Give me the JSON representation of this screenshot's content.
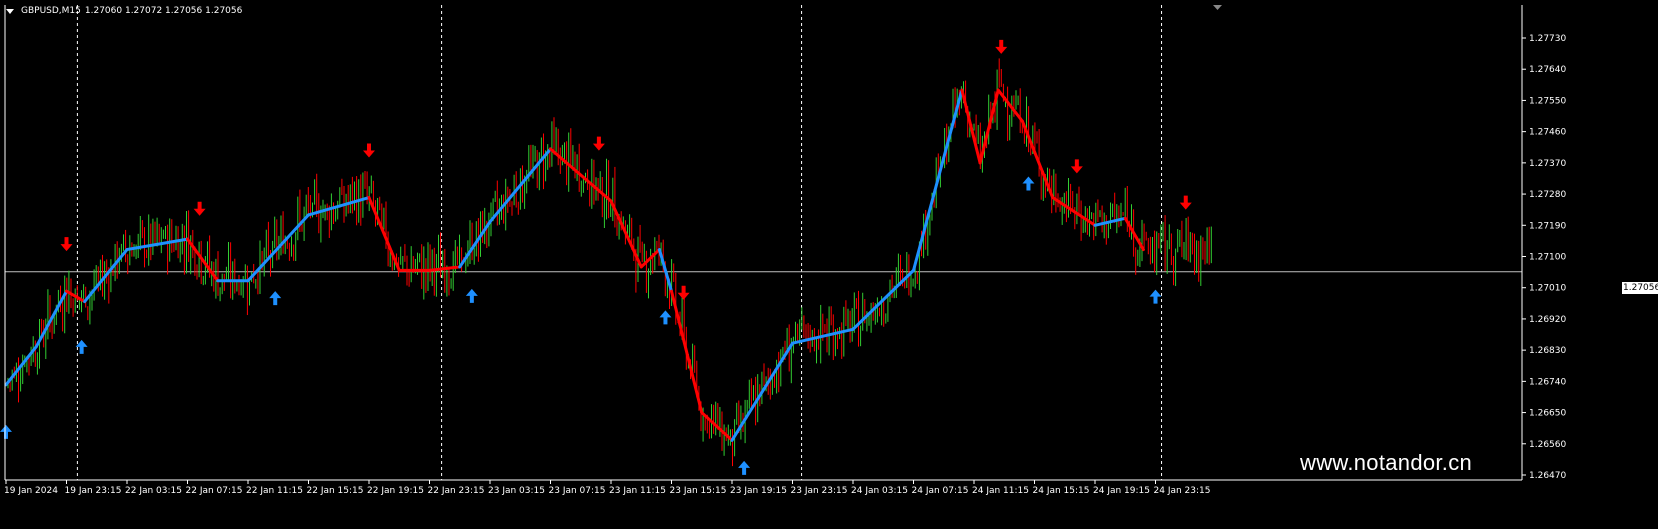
{
  "header": {
    "symbol_timeframe": "GBPUSD,M15",
    "quote_text": "1.27060 1.27072 1.27056 1.27056"
  },
  "price_axis": {
    "labels": [
      "1.27730",
      "1.27640",
      "1.27550",
      "1.27460",
      "1.27370",
      "1.27280",
      "1.27190",
      "1.27100",
      "1.27010",
      "1.26920",
      "1.26830",
      "1.26740",
      "1.26650",
      "1.26560",
      "1.26470"
    ],
    "current_price": "1.27056"
  },
  "time_axis": {
    "labels": [
      "19 Jan 2024",
      "19 Jan 23:15",
      "22 Jan 03:15",
      "22 Jan 07:15",
      "22 Jan 11:15",
      "22 Jan 15:15",
      "22 Jan 19:15",
      "22 Jan 23:15",
      "23 Jan 03:15",
      "23 Jan 07:15",
      "23 Jan 11:15",
      "23 Jan 15:15",
      "23 Jan 19:15",
      "23 Jan 23:15",
      "24 Jan 03:15",
      "24 Jan 07:15",
      "24 Jan 11:15",
      "24 Jan 15:15",
      "24 Jan 19:15",
      "24 Jan 23:15"
    ]
  },
  "watermark": "www.notandor.cn",
  "colors": {
    "background": "#000000",
    "bull_candle": "#32cd32",
    "bear_candle": "#ff0000",
    "trend_up": "#1e90ff",
    "trend_down": "#ff0000",
    "signal_up": "#1e90ff",
    "signal_down": "#ff0000",
    "grid_separator": "#ffffff"
  },
  "chart_data": {
    "type": "line",
    "symbol": "GBPUSD",
    "timeframe": "M15",
    "ylim": [
      1.2647,
      1.2782
    ],
    "current_price": 1.27056,
    "x_labels": [
      "19 Jan 2024",
      "19 Jan 23:15",
      "22 Jan 03:15",
      "22 Jan 07:15",
      "22 Jan 11:15",
      "22 Jan 15:15",
      "22 Jan 19:15",
      "22 Jan 23:15",
      "23 Jan 03:15",
      "23 Jan 07:15",
      "23 Jan 11:15",
      "23 Jan 15:15",
      "23 Jan 19:15",
      "23 Jan 23:15",
      "24 Jan 03:15",
      "24 Jan 07:15",
      "24 Jan 11:15",
      "24 Jan 15:15",
      "24 Jan 19:15",
      "24 Jan 23:15"
    ],
    "series": [
      {
        "points": [
          [
            0,
            1.2673,
            "up"
          ],
          [
            0.5,
            1.2684,
            "up"
          ],
          [
            1,
            1.27,
            "down"
          ],
          [
            1.3,
            1.2697,
            "up"
          ],
          [
            2,
            1.2712,
            "up"
          ],
          [
            3,
            1.2715,
            "down"
          ],
          [
            3.5,
            1.2703,
            "up"
          ],
          [
            4,
            1.2703,
            "up"
          ],
          [
            5,
            1.2722,
            "up"
          ],
          [
            6,
            1.2727,
            "down"
          ],
          [
            6.5,
            1.2706,
            "down"
          ],
          [
            7,
            1.2706,
            "down"
          ],
          [
            7.5,
            1.2707,
            "up"
          ],
          [
            8,
            1.272,
            "up"
          ],
          [
            9,
            1.2741,
            "down"
          ],
          [
            10,
            1.2726,
            "down"
          ],
          [
            10.5,
            1.2707,
            "down"
          ],
          [
            10.8,
            1.2712,
            "up"
          ],
          [
            11,
            1.27,
            "down"
          ],
          [
            11.5,
            1.2665,
            "down"
          ],
          [
            12,
            1.2657,
            "up"
          ],
          [
            13,
            1.2685,
            "up"
          ],
          [
            14,
            1.2689,
            "up"
          ],
          [
            15,
            1.2706,
            "up"
          ],
          [
            15.8,
            1.2758,
            "down"
          ],
          [
            16.1,
            1.2737,
            "down"
          ],
          [
            16.4,
            1.2758,
            "down"
          ],
          [
            16.8,
            1.2749,
            "down"
          ],
          [
            17.3,
            1.2727,
            "down"
          ],
          [
            18,
            1.2719,
            "up"
          ],
          [
            18.5,
            1.2721,
            "down"
          ],
          [
            18.8,
            1.2712,
            "down"
          ]
        ]
      }
    ],
    "signals": [
      {
        "x": 0.0,
        "type": "buy"
      },
      {
        "x": 1.0,
        "type": "sell"
      },
      {
        "x": 1.25,
        "type": "buy"
      },
      {
        "x": 3.2,
        "type": "sell"
      },
      {
        "x": 4.45,
        "type": "buy"
      },
      {
        "x": 6.0,
        "type": "sell"
      },
      {
        "x": 7.7,
        "type": "buy"
      },
      {
        "x": 9.8,
        "type": "sell"
      },
      {
        "x": 10.9,
        "type": "buy"
      },
      {
        "x": 11.2,
        "type": "sell"
      },
      {
        "x": 12.2,
        "type": "buy"
      },
      {
        "x": 16.45,
        "type": "sell"
      },
      {
        "x": 16.9,
        "type": "buy"
      },
      {
        "x": 17.7,
        "type": "sell"
      },
      {
        "x": 19.0,
        "type": "buy"
      },
      {
        "x": 19.5,
        "type": "sell"
      }
    ]
  }
}
